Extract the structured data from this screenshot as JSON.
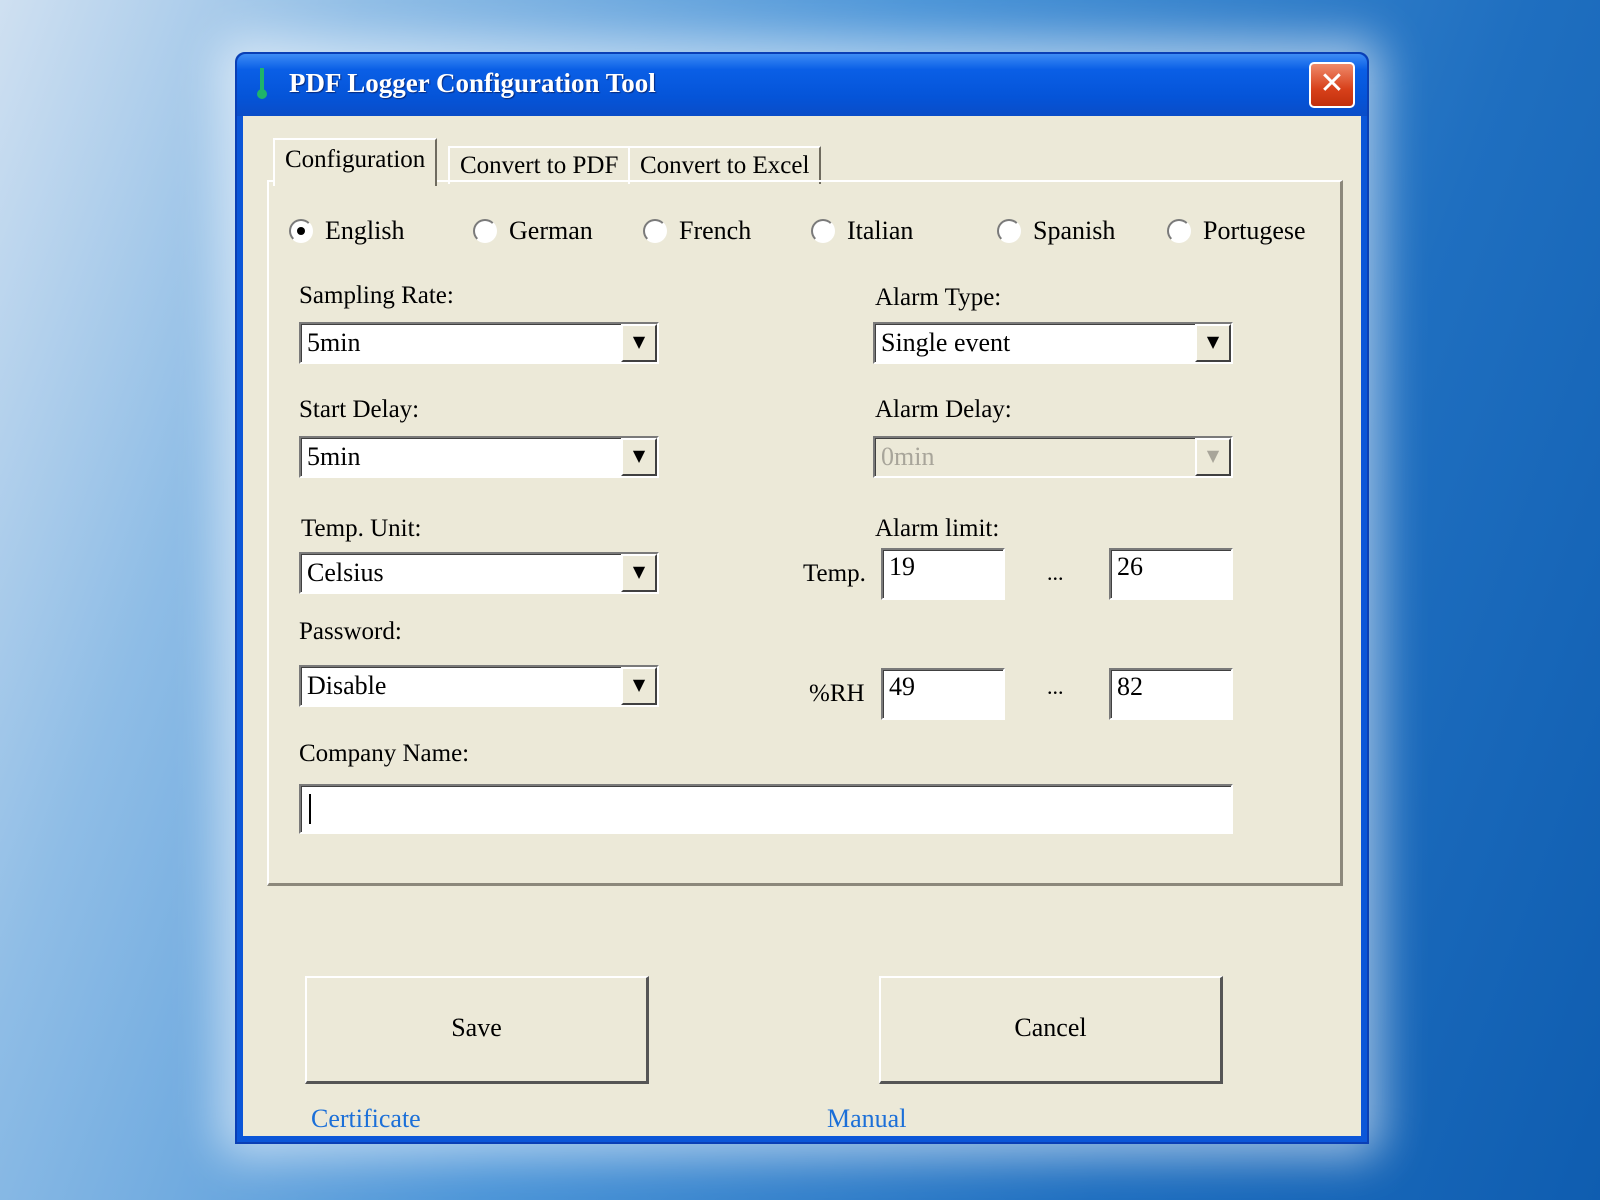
{
  "window": {
    "title": "PDF Logger Configuration Tool",
    "close_label": "✕"
  },
  "tabs": [
    {
      "label": "Configuration",
      "active": true
    },
    {
      "label": "Convert to PDF",
      "active": false
    },
    {
      "label": "Convert to Excel",
      "active": false
    }
  ],
  "languages": [
    {
      "label": "English",
      "selected": true
    },
    {
      "label": "German",
      "selected": false
    },
    {
      "label": "French",
      "selected": false
    },
    {
      "label": "Italian",
      "selected": false
    },
    {
      "label": "Spanish",
      "selected": false
    },
    {
      "label": "Portugese",
      "selected": false
    }
  ],
  "sampling_rate": {
    "label": "Sampling Rate:",
    "value": "5min"
  },
  "start_delay": {
    "label": "Start Delay:",
    "value": "5min"
  },
  "temp_unit": {
    "label": "Temp. Unit:",
    "value": "Celsius"
  },
  "password": {
    "label": "Password:",
    "value": "Disable"
  },
  "alarm_type": {
    "label": "Alarm Type:",
    "value": "Single event"
  },
  "alarm_delay": {
    "label": "Alarm Delay:",
    "value": "0min",
    "disabled": true
  },
  "alarm_limit": {
    "label": "Alarm limit:",
    "temp_label": "Temp.",
    "temp_low": "19",
    "temp_high": "26",
    "rh_label": "%RH",
    "rh_low": "49",
    "rh_high": "82",
    "separator": "..."
  },
  "company_name": {
    "label": "Company Name:",
    "value": ""
  },
  "buttons": {
    "save": "Save",
    "cancel": "Cancel"
  },
  "links": {
    "certificate": "Certificate",
    "manual": "Manual"
  },
  "icons": {
    "app": "thermometer-icon",
    "dropdown": "chevron-down-icon",
    "close": "close-icon"
  },
  "colors": {
    "title_bar": "#0554d8",
    "client_bg": "#ece9d8",
    "link": "#1b6fd8",
    "close_button": "#d7401a"
  }
}
